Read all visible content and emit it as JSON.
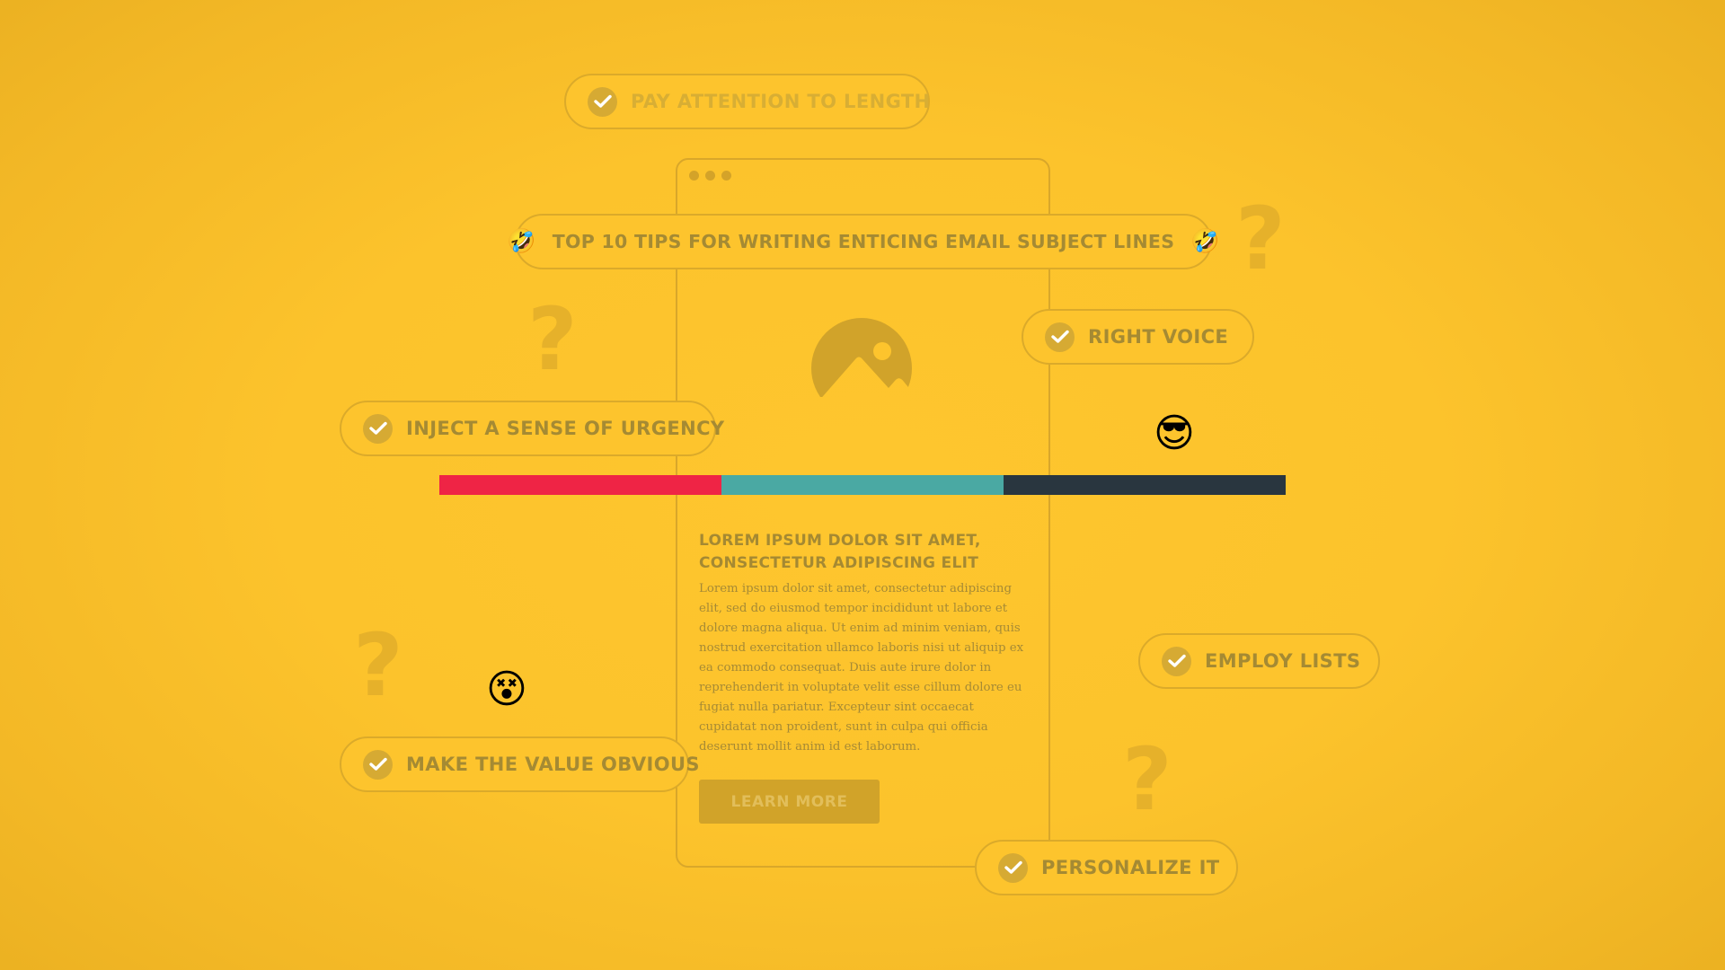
{
  "window": {
    "dots": [
      "dot",
      "dot",
      "dot"
    ],
    "image_icon": "image-placeholder-icon"
  },
  "title_pill": {
    "text": "Top 10 tips for writing enticing email subject lines",
    "emoji_left": "🤣",
    "emoji_right": "🤣"
  },
  "tips": [
    {
      "label": "Pay attention to length",
      "icon": "check-icon"
    },
    {
      "label": "Right voice",
      "icon": "check-icon"
    },
    {
      "label": "Inject a sense of urgency",
      "icon": "check-icon"
    },
    {
      "label": "Employ lists",
      "icon": "check-icon"
    },
    {
      "label": "Make the value obvious",
      "icon": "check-icon"
    },
    {
      "label": "Personalize it",
      "icon": "check-icon"
    }
  ],
  "color_bar": {
    "segments": [
      {
        "color": "#EF2445",
        "share": 0.3333
      },
      {
        "color": "#4AA9A3",
        "share": 0.3333
      },
      {
        "color": "#29363F",
        "share": 0.3334
      }
    ]
  },
  "content": {
    "heading": "Lorem ipsum dolor sit amet, consectetur adipiscing elit",
    "body": "Lorem ipsum dolor sit amet, consectetur adipiscing elit, sed do eiusmod tempor incididunt ut labore et dolore magna aliqua. Ut enim ad minim veniam, quis nostrud exercitation ullamco laboris nisi ut aliquip ex ea commodo consequat. Duis aute irure dolor in reprehenderit in voluptate velit esse cillum dolore eu fugiat nulla pariatur. Excepteur sint occaecat cupidatat non proident, sunt in culpa qui officia deserunt mollit anim id est laborum.",
    "button_label": "Learn more"
  },
  "decorations": {
    "question_mark": "?",
    "emoji_cool": "😎",
    "emoji_dizzy": "😵"
  }
}
